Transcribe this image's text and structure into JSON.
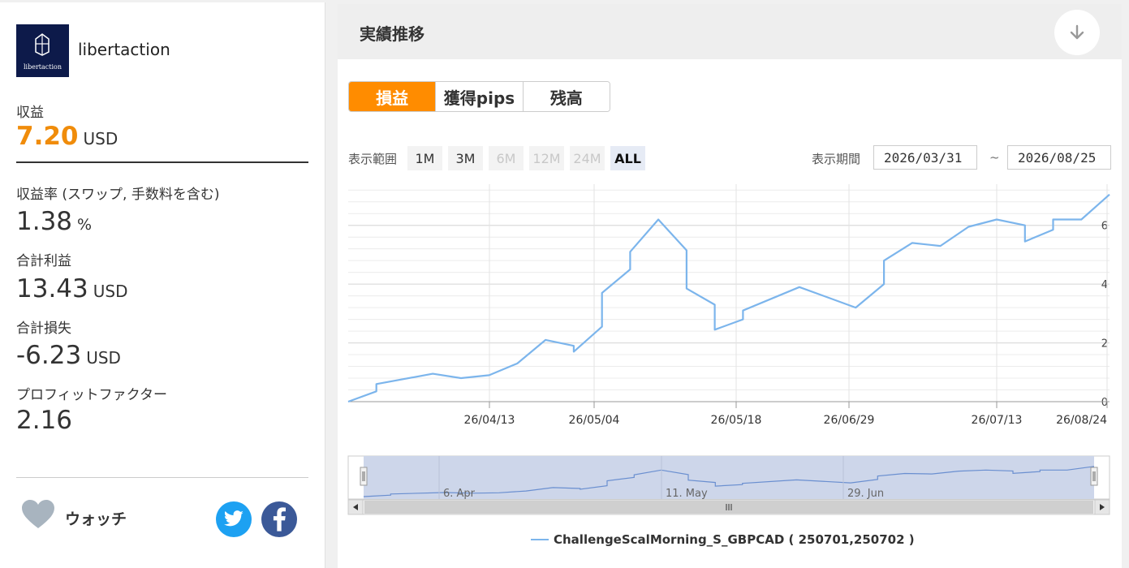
{
  "account": {
    "name": "libertaction",
    "logo_text": "libertaction"
  },
  "stats": {
    "profit_label": "収益",
    "profit_value": "7.20",
    "profit_unit": "USD",
    "rate_label": "収益率 (スワップ, 手数料を含む)",
    "rate_value": "1.38",
    "rate_unit": "%",
    "total_profit_label": "合計利益",
    "total_profit_value": "13.43",
    "total_profit_unit": "USD",
    "total_loss_label": "合計損失",
    "total_loss_value": "-6.23",
    "total_loss_unit": "USD",
    "pf_label": "プロフィットファクター",
    "pf_value": "2.16"
  },
  "watch": {
    "label": "ウォッチ"
  },
  "social": {
    "icons": [
      "twitter-icon",
      "facebook-icon"
    ],
    "twitter_color": "#1da1f2",
    "facebook_color": "#3b5998"
  },
  "panel": {
    "title": "実績推移"
  },
  "tabs": [
    {
      "label": "損益",
      "active": true
    },
    {
      "label": "獲得pips",
      "active": false
    },
    {
      "label": "残高",
      "active": false
    }
  ],
  "range": {
    "label": "表示範囲",
    "buttons": [
      {
        "label": "1M",
        "state": "normal"
      },
      {
        "label": "3M",
        "state": "normal"
      },
      {
        "label": "6M",
        "state": "disabled"
      },
      {
        "label": "12M",
        "state": "disabled"
      },
      {
        "label": "24M",
        "state": "disabled"
      },
      {
        "label": "ALL",
        "state": "selected"
      }
    ]
  },
  "period": {
    "label": "表示期間",
    "from": "2026/03/31",
    "to": "2026/08/25",
    "separator": "~"
  },
  "colors": {
    "accent": "#ff8c00",
    "profit": "#f08c0a",
    "series": "#7cb5ec",
    "navigator_fill": "#cdd6ea"
  },
  "chart_data": {
    "type": "line",
    "x_tick_labels": [
      "26/04/13",
      "26/05/04",
      "26/05/18",
      "26/06/29",
      "26/07/13",
      "26/08/24"
    ],
    "y_ticks": [
      0,
      2,
      4,
      6
    ],
    "ylim": [
      0,
      7.4
    ],
    "grid": true,
    "legend_position": "bottom",
    "series": [
      {
        "name": "ChallengeScalMorning_S_GBPCAD ( 250701,250702 )",
        "points": [
          [
            0,
            0
          ],
          [
            3,
            0.35
          ],
          [
            3,
            0.6
          ],
          [
            9,
            0.95
          ],
          [
            12,
            0.8
          ],
          [
            15,
            0.9
          ],
          [
            18,
            1.3
          ],
          [
            21,
            2.1
          ],
          [
            24,
            1.9
          ],
          [
            24,
            1.7
          ],
          [
            27,
            2.55
          ],
          [
            27,
            3.7
          ],
          [
            30,
            4.5
          ],
          [
            30,
            5.1
          ],
          [
            33,
            6.2
          ],
          [
            36,
            5.15
          ],
          [
            36,
            3.85
          ],
          [
            39,
            3.3
          ],
          [
            39,
            2.45
          ],
          [
            42,
            2.8
          ],
          [
            42,
            3.1
          ],
          [
            48,
            3.9
          ],
          [
            54,
            3.2
          ],
          [
            57,
            4.0
          ],
          [
            57,
            4.8
          ],
          [
            60,
            5.4
          ],
          [
            63,
            5.3
          ],
          [
            66,
            5.95
          ],
          [
            69,
            6.2
          ],
          [
            72,
            6.0
          ],
          [
            72,
            5.45
          ],
          [
            75,
            5.85
          ],
          [
            75,
            6.2
          ],
          [
            78,
            6.2
          ],
          [
            81,
            7.05
          ]
        ]
      }
    ],
    "navigator_labels": [
      "6. Apr",
      "11. May",
      "29. Jun"
    ]
  }
}
